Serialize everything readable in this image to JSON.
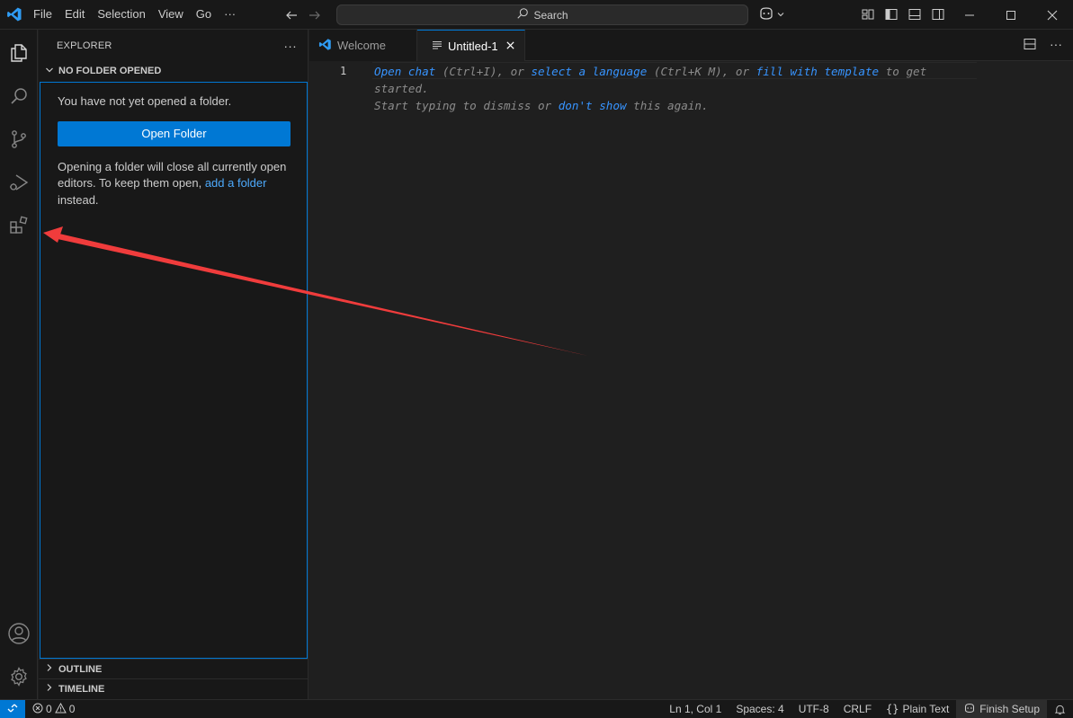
{
  "menu": {
    "file": "File",
    "edit": "Edit",
    "selection": "Selection",
    "view": "View",
    "go": "Go",
    "more": "···"
  },
  "search": {
    "label": "Search"
  },
  "sidebar": {
    "title": "EXPLORER",
    "more": "···",
    "section_title": "NO FOLDER OPENED",
    "message": "You have not yet opened a folder.",
    "open_folder_label": "Open Folder",
    "info_before": "Opening a folder will close all currently open editors. To keep them open, ",
    "info_link": "add a folder",
    "info_after": " instead.",
    "outline": "OUTLINE",
    "timeline": "TIMELINE"
  },
  "tabs": [
    {
      "label": "Welcome"
    },
    {
      "label": "Untitled-1"
    }
  ],
  "editor": {
    "line_number": "1",
    "hint": {
      "open_chat": "Open chat",
      "part1": " (Ctrl+I), or ",
      "select_language": "select a language",
      "part2": " (Ctrl+K M), or ",
      "fill_template": "fill with template",
      "part3": " to get started.",
      "line2_start": "Start typing to dismiss or ",
      "dont_show": "don't show",
      "line2_end": " this again."
    }
  },
  "status": {
    "errors": "0",
    "warnings": "0",
    "position": "Ln 1, Col 1",
    "spaces": "Spaces: 4",
    "encoding": "UTF-8",
    "eol": "CRLF",
    "language": "Plain Text",
    "finish_setup": "Finish Setup"
  },
  "colors": {
    "accent": "#0078d4",
    "link": "#3794ff",
    "annotation_arrow": "#f03c3c"
  }
}
